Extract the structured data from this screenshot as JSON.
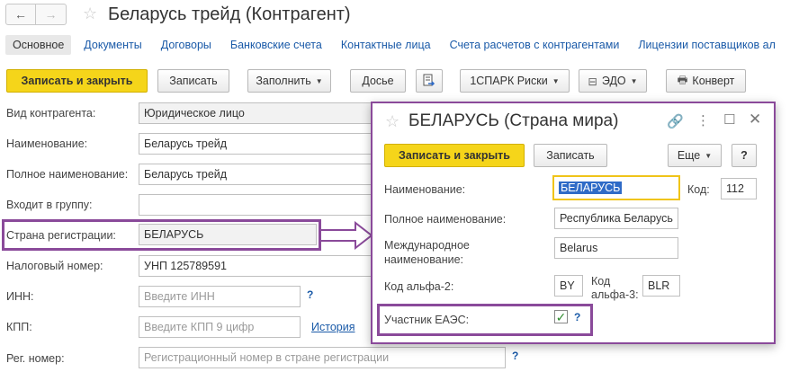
{
  "header": {
    "title": "Беларусь трейд (Контрагент)",
    "back_glyph": "←",
    "forward_glyph": "→"
  },
  "tabs": [
    {
      "label": "Основное",
      "active": true
    },
    {
      "label": "Документы"
    },
    {
      "label": "Договоры"
    },
    {
      "label": "Банковские счета"
    },
    {
      "label": "Контактные лица"
    },
    {
      "label": "Счета расчетов с контрагентами"
    },
    {
      "label": "Лицензии поставщиков ал"
    }
  ],
  "toolbar": {
    "save_close": "Записать и закрыть",
    "save": "Записать",
    "fill": "Заполнить",
    "dossier": "Досье",
    "spark": "1СПАРК Риски",
    "edo": "ЭДО",
    "envelope": "Конверт"
  },
  "form": {
    "type_label": "Вид контрагента:",
    "type_value": "Юридическое лицо",
    "name_label": "Наименование:",
    "name_value": "Беларусь трейд",
    "full_name_label": "Полное наименование:",
    "full_name_value": "Беларусь трейд",
    "group_label": "Входит в группу:",
    "group_value": "",
    "country_label": "Страна регистрации:",
    "country_value": "БЕЛАРУСЬ",
    "tax_label": "Налоговый номер:",
    "tax_value": "УНП 125789591",
    "inn_label": "ИНН:",
    "inn_placeholder": "Введите ИНН",
    "kpp_label": "КПП:",
    "kpp_placeholder": "Введите КПП 9 цифр",
    "history_link": "История",
    "reg_label": "Рег. номер:",
    "reg_placeholder": "Регистрационный номер в стране регистрации",
    "help": "?"
  },
  "dialog": {
    "title": "БЕЛАРУСЬ (Страна мира)",
    "save_close": "Записать и закрыть",
    "save": "Записать",
    "more": "Еще",
    "help": "?",
    "name_label": "Наименование:",
    "name_value": "БЕЛАРУСЬ",
    "code_label": "Код:",
    "code_value": "112",
    "full_label": "Полное наименование:",
    "full_value": "Республика Беларусь",
    "intl_label_1": "Международное",
    "intl_label_2": "наименование:",
    "intl_value": "Belarus",
    "alpha2_label": "Код альфа-2:",
    "alpha2_value": "BY",
    "alpha3_label_1": "Код",
    "alpha3_label_2": "альфа-3:",
    "alpha3_value": "BLR",
    "eaeu_label": "Участник ЕАЭС:",
    "eaeu_checked": true
  },
  "colors": {
    "accent_yellow": "#f5d51a",
    "highlight_purple": "#8a4a9a",
    "link_blue": "#1a5aa8",
    "check_green": "#2e8b2e"
  }
}
